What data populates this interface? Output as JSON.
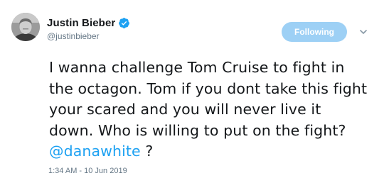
{
  "tweet": {
    "author": {
      "display_name": "Justin Bieber",
      "handle": "@justinbieber",
      "verified": true
    },
    "follow_button_label": "Following",
    "text_before": "I wanna challenge Tom Cruise to fight in the octagon. Tom if you dont take this fight your scared and you will never live it down. Who is willing to put on the fight? ",
    "mention": "@danawhite",
    "text_after": " ?",
    "timestamp": "1:34 AM - 10 Jun 2019"
  },
  "icons": {
    "verified": "verified-badge-icon",
    "menu": "chevron-down-icon"
  },
  "colors": {
    "accent": "#1da1f2",
    "follow_button_bg": "#9dd0f5",
    "text_primary": "#14171a",
    "text_secondary": "#657786"
  }
}
